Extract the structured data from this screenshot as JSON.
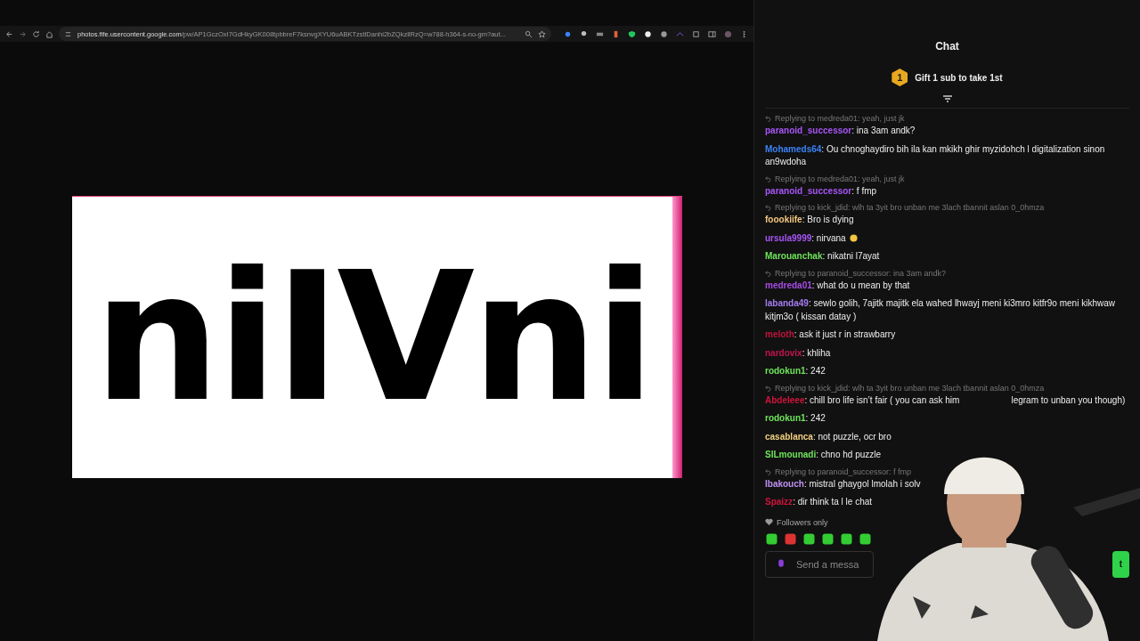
{
  "browser": {
    "url": "photos.fife.usercontent.google.com",
    "url_rest": "/pw/AP1GczOxI7GdHkyGK008tpbbreF7ksnvgXYU6uABKTzstlDanhi2bZQkzllRzQ=w788-h364-s-no-gm?aut..."
  },
  "image": {
    "text": "niIVni"
  },
  "chat": {
    "title": "Chat",
    "gift": {
      "rank": "1",
      "label": "Gift 1 sub to take 1st"
    },
    "messages": [
      {
        "reply": "Replying to medreda01: yeah, just jk",
        "user": "paranoid_successor",
        "color": "#a855f7",
        "text": ": ina 3am andk?"
      },
      {
        "user": "Mohameds64",
        "color": "#3b82f6",
        "text": ": Ou chnoghaydiro bih ila kan mkikh ghir myzidohch l digitalization sinon an9wdoha"
      },
      {
        "reply": "Replying to medreda01: yeah, just jk",
        "user": "paranoid_successor",
        "color": "#a855f7",
        "text": ": f fmp"
      },
      {
        "reply": "Replying to kick_jdid: wlh ta 3yit bro unban me 3lach tbannit aslan 0_0hmza",
        "user": "foookiife",
        "color": "#f5c882",
        "text": ": Bro is dying"
      },
      {
        "user": "ursula9999",
        "color": "#a855f7",
        "text": ": nirvana",
        "emoji": true
      },
      {
        "user": "Marouanchak",
        "color": "#6ee35a",
        "text": ": nikatni l7ayat"
      },
      {
        "reply": "Replying to paranoid_successor: ina 3am andk?",
        "user": "medreda01",
        "color": "#a64be6",
        "text": ": what do u mean by that"
      },
      {
        "user": "labanda49",
        "color": "#a47cf0",
        "text": ": sewlo golih, 7ajitk majitk ela wahed lhwayj meni ki3mro kitfr9o meni kikhwaw kitjm3o ( kissan datay )"
      },
      {
        "user": "meloth",
        "color": "#c0143c",
        "text": ": ask it just r in strawbarry"
      },
      {
        "user": "nardovix",
        "color": "#c0144f",
        "text": ": khliha"
      },
      {
        "user": "rodokun1",
        "color": "#6ee35a",
        "text": ": 242"
      },
      {
        "reply": "Replying to kick_jdid: wlh ta 3yit bro unban me 3lach tbannit aslan 0_0hmza",
        "user": "Abdeleee",
        "color": "#d0143c",
        "text": ": chill bro life isn’t fair ( you can ask him",
        "tail": "legram to unban you though)"
      },
      {
        "user": "rodokun1",
        "color": "#6ee35a",
        "text": ": 242"
      },
      {
        "user": "casablanca",
        "color": "#f0d080",
        "text": ": not puzzle, ocr bro"
      },
      {
        "user": "SILmounadi",
        "color": "#6ee35a",
        "text": ": chno hd puzzle"
      },
      {
        "reply": "Replying to paranoid_successor: f fmp",
        "user": "Ibakouch",
        "color": "#c090f0",
        "text": ": mistral ghaygol lmolah i solv"
      },
      {
        "user": "Spaizz",
        "color": "#d0143c",
        "text": ": dir think ta l le chat"
      }
    ],
    "mode": "Followers only",
    "input": {
      "placeholder": "Send a messa"
    },
    "send": "t"
  }
}
